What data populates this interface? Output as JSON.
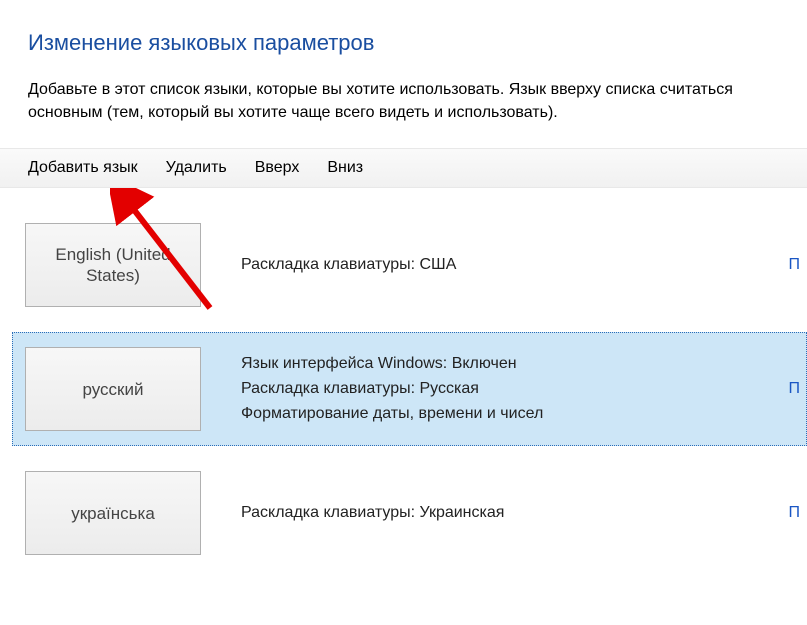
{
  "heading": "Изменение языковых параметров",
  "description": "Добавьте в этот список языки, которые вы хотите использовать. Язык вверху списка считаться основным (тем, который вы хотите чаще всего видеть и использовать).",
  "toolbar": {
    "add": "Добавить язык",
    "remove": "Удалить",
    "up": "Вверх",
    "down": "Вниз"
  },
  "languages": [
    {
      "tile": "English (United States)",
      "lines": [
        "Раскладка клавиатуры: США"
      ],
      "link": "П",
      "selected": false
    },
    {
      "tile": "русский",
      "lines": [
        "Язык интерфейса Windows: Включен",
        "Раскладка клавиатуры: Русская",
        "Форматирование даты, времени и чисел"
      ],
      "link": "П",
      "selected": true
    },
    {
      "tile": "українська",
      "lines": [
        "Раскладка клавиатуры: Украинская"
      ],
      "link": "П",
      "selected": false
    }
  ]
}
